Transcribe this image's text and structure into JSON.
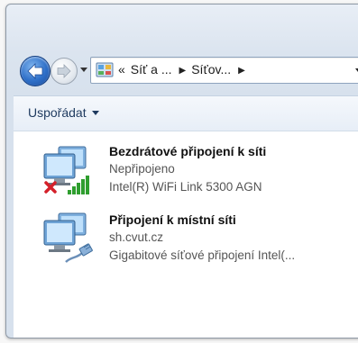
{
  "navigation": {
    "back_icon": "back-arrow-icon",
    "forward_icon": "forward-arrow-icon",
    "address": {
      "prefix": "«",
      "crumbs": [
        "Síť a ...",
        "Síťov..."
      ],
      "icon": "control-panel-icon"
    }
  },
  "toolbar": {
    "organize_label": "Uspořádat"
  },
  "connections": [
    {
      "name": "Bezdrátové připojení k síti",
      "status": "Nepřipojeno",
      "device": "Intel(R) WiFi Link 5300 AGN",
      "icon": "wireless-network-disconnected-icon"
    },
    {
      "name": "Připojení k místní síti",
      "status": "sh.cvut.cz",
      "device": "Gigabitové síťové připojení Intel(...",
      "icon": "wired-network-icon"
    }
  ],
  "colors": {
    "accent": "#2e6fc8",
    "error_x": "#d4202a",
    "signal": "#2f9e2f"
  }
}
